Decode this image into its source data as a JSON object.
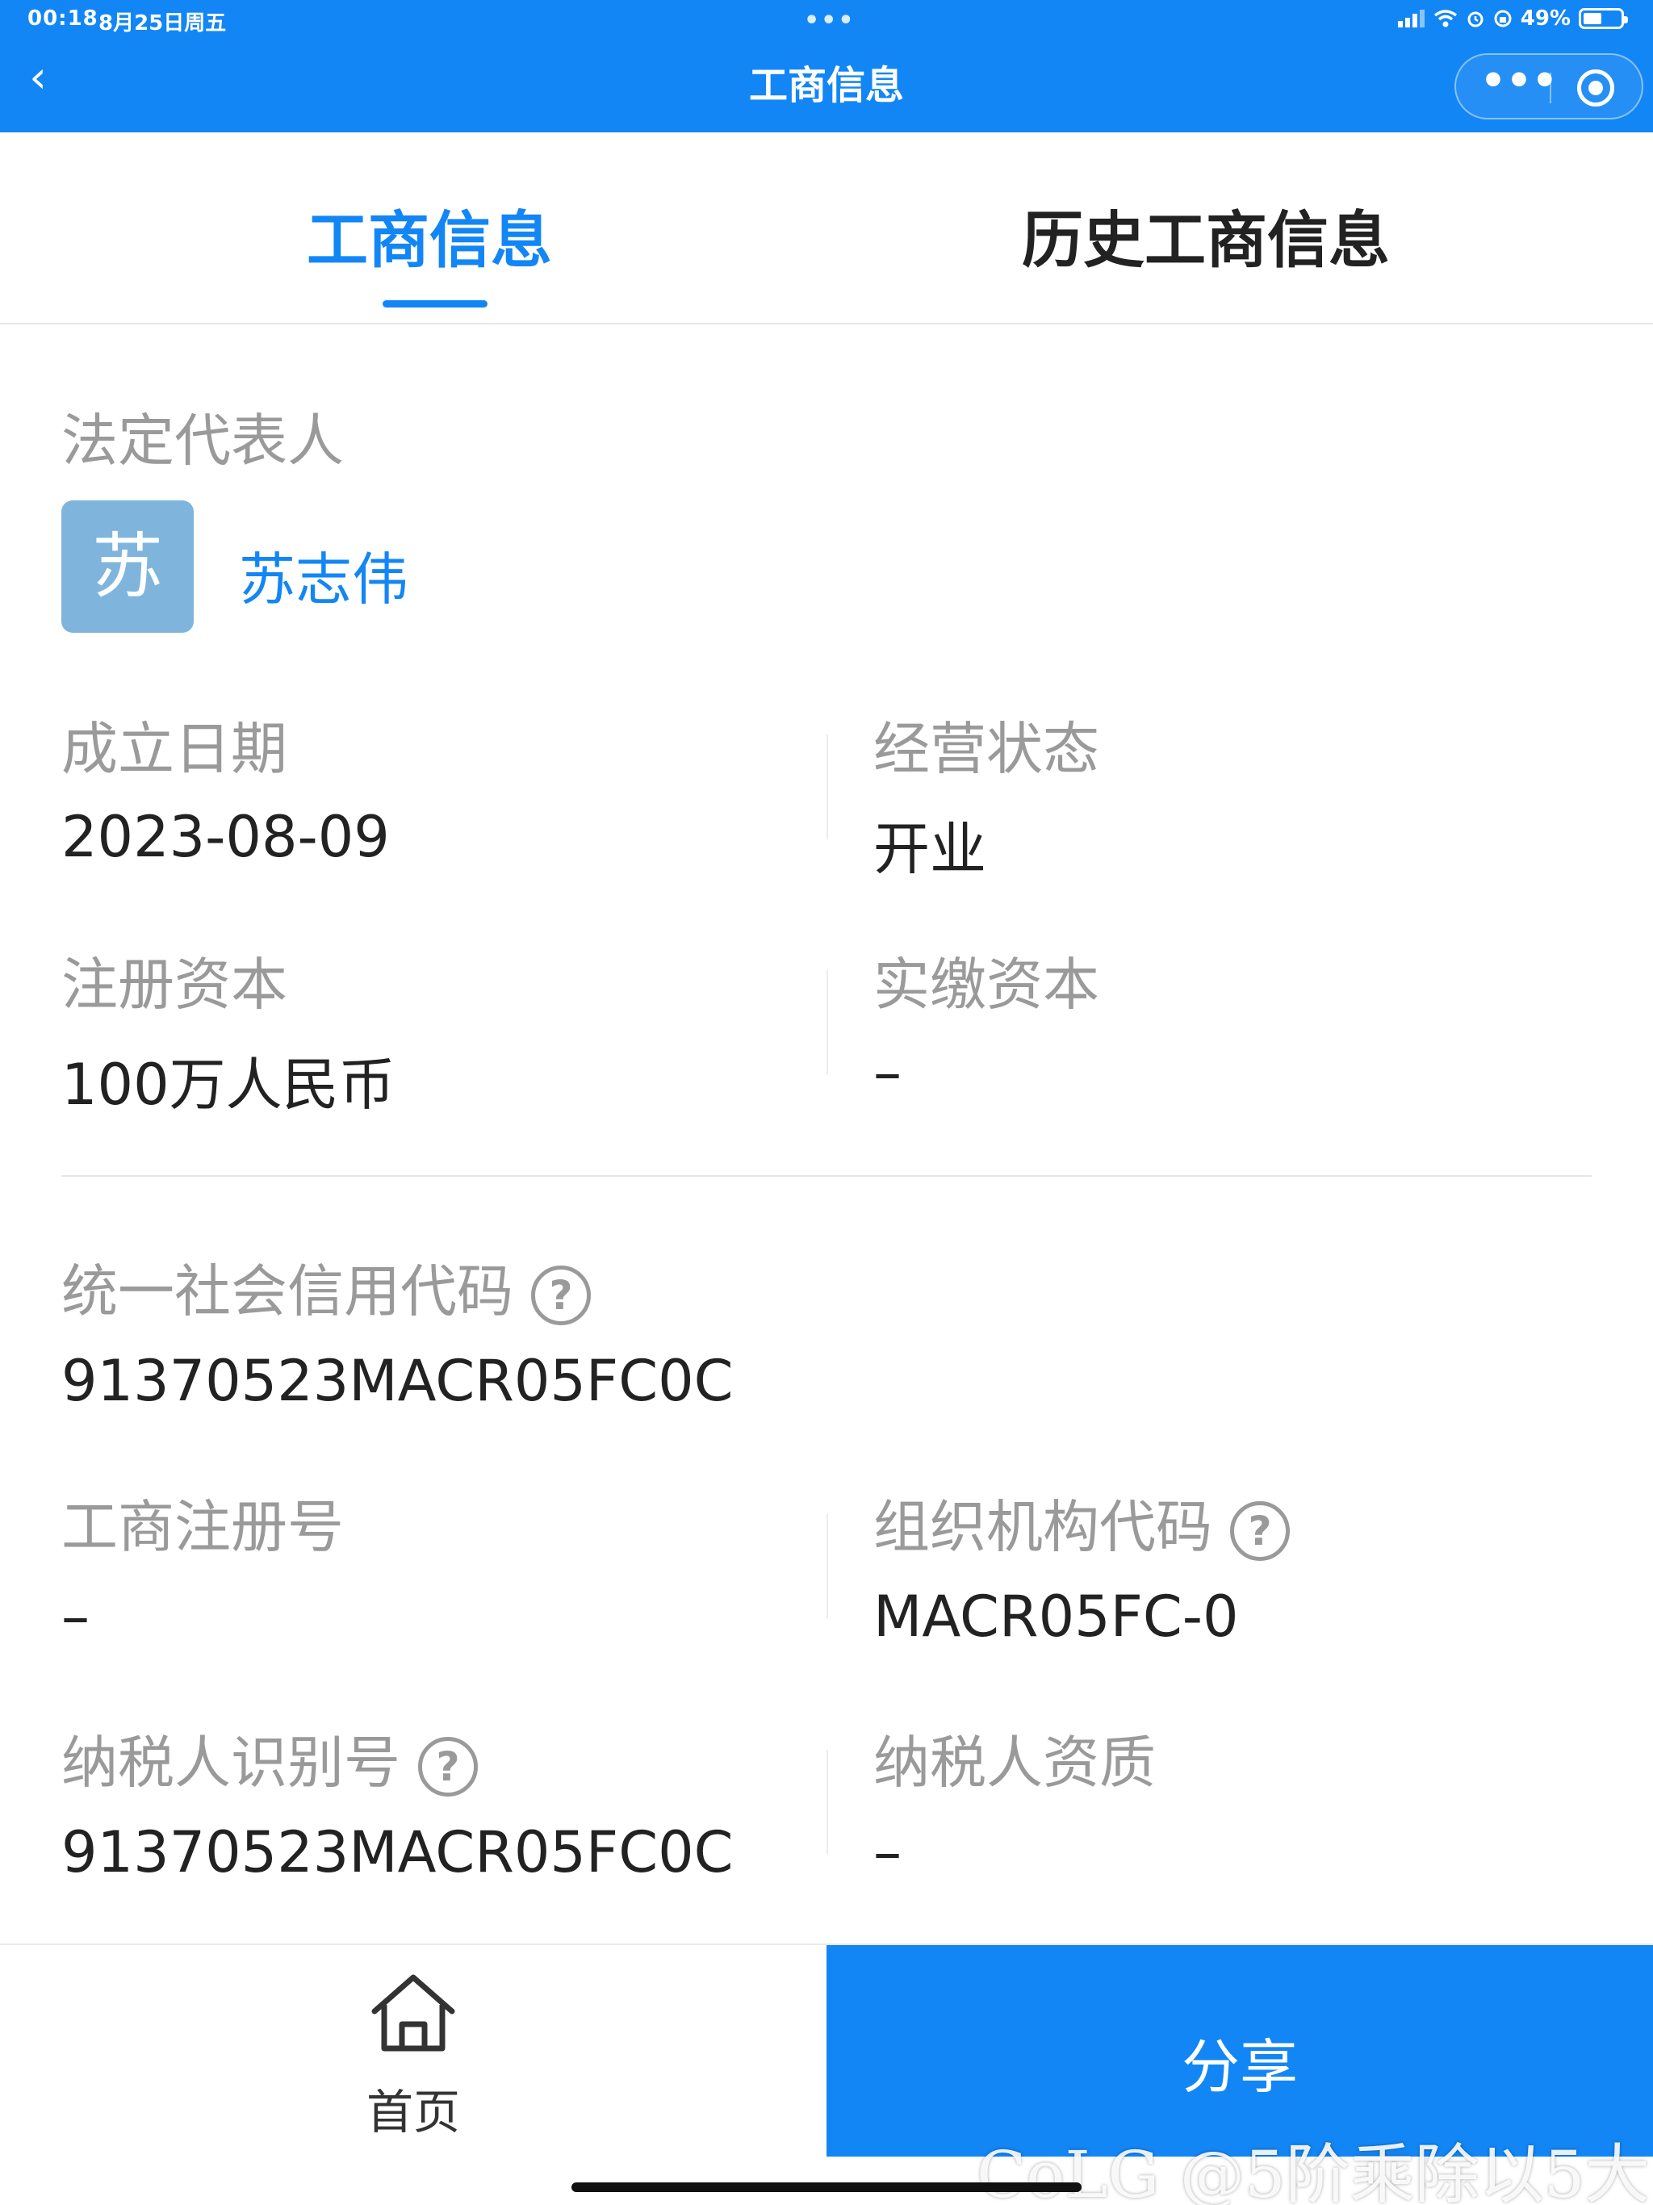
{
  "status_bar": {
    "time": "00:18",
    "date": "8月25日周五",
    "dots": "•••",
    "battery_percent": "49%",
    "battery_level": 0.49
  },
  "nav": {
    "back_glyph": "‹",
    "title": "工商信息",
    "more_glyph": "•••"
  },
  "tabs": [
    {
      "label": "工商信息",
      "active": true
    },
    {
      "label": "历史工商信息",
      "active": false
    }
  ],
  "legal_rep": {
    "label": "法定代表人",
    "avatar_char": "苏",
    "name": "苏志伟"
  },
  "fields": {
    "established": {
      "label": "成立日期",
      "value": "2023-08-09"
    },
    "status": {
      "label": "经营状态",
      "value": "开业"
    },
    "registered_capital": {
      "label": "注册资本",
      "value": "100万人民币"
    },
    "paid_capital": {
      "label": "实缴资本",
      "value": "–"
    },
    "credit_code": {
      "label": "统一社会信用代码",
      "value": "91370523MACR05FC0C"
    },
    "reg_number": {
      "label": "工商注册号",
      "value": "–"
    },
    "org_code": {
      "label": "组织机构代码",
      "value": "MACR05FC-0"
    },
    "taxpayer_id": {
      "label": "纳税人识别号",
      "value": "91370523MACR05FC0C"
    },
    "taxpayer_qual": {
      "label": "纳税人资质",
      "value": "–"
    }
  },
  "help_glyph": "?",
  "bottom": {
    "home_label": "首页",
    "share_label": "分享"
  },
  "watermark": "CoLG @5阶乘除以5大",
  "colors": {
    "accent": "#1386f5",
    "avatar_bg": "#7fb5dc",
    "label_gray": "#9a9a9a",
    "text": "#222222"
  }
}
